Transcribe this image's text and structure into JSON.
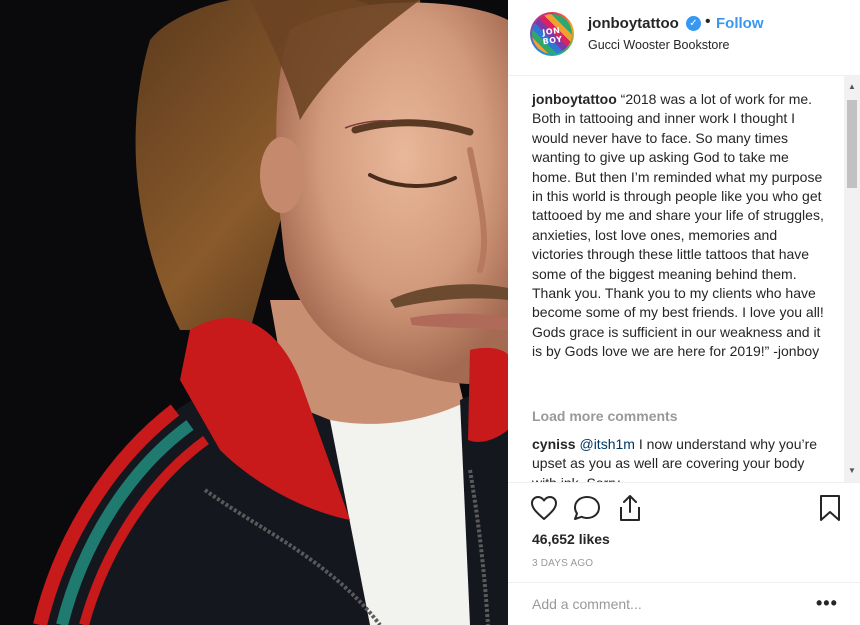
{
  "post": {
    "username": "jonboytattoo",
    "follow_label": "Follow",
    "location": "Gucci Wooster Bookstore",
    "avatar_text": "JON BOY",
    "verified_symbol": "✓",
    "separator": "•"
  },
  "caption": {
    "author": "jonboytattoo",
    "text": "“2018 was a lot of work for me. Both in tattooing and inner work I thought I would never have to face. So many times wanting to give up asking God to take me home. But then I’m reminded what my purpose in this world is through people like you who get tattooed by me and share your life of struggles, anxieties, lost love ones, memories and victories through these little tattoos that have some of the biggest meaning behind them. Thank you. Thank you to my clients who have become some of my best friends. I love you all! Gods grace is sufficient in our weakness and it is by Gods love we are here for 2019!” -jonboy"
  },
  "load_more_label": "Load more comments",
  "comment": {
    "author": "cyniss",
    "mention": "@itsh1m",
    "text": " I now understand why you’re upset as you as well are covering your body with ink. Sorry"
  },
  "actions": {
    "icons": [
      "heart-icon",
      "comment-icon",
      "share-icon",
      "bookmark-icon"
    ]
  },
  "likes_text": "46,652 likes",
  "timestamp": "3 DAYS AGO",
  "add_comment_placeholder": "Add a comment...",
  "more_label": "•••",
  "colors": {
    "link_blue": "#3897f0",
    "text": "#262626",
    "muted": "#999999",
    "mention": "#003569"
  }
}
